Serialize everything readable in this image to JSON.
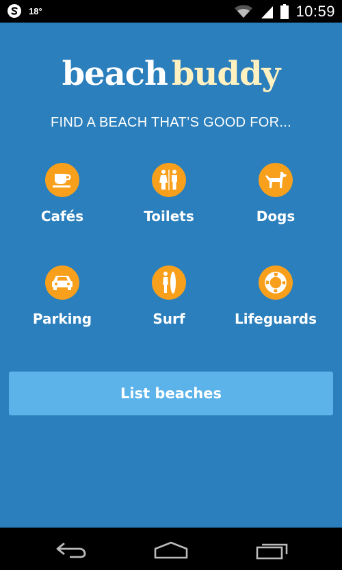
{
  "status_bar": {
    "temperature": "18°",
    "time": "10:59",
    "icons": [
      "app-s-icon",
      "wifi-icon",
      "cell-signal-icon",
      "battery-icon"
    ]
  },
  "logo": {
    "word1": "beach",
    "word2": "buddy"
  },
  "subtitle": "FIND A BEACH THAT’S GOOD FOR...",
  "features": [
    {
      "label": "Cafés",
      "icon": "coffee-cup-icon"
    },
    {
      "label": "Toilets",
      "icon": "toilets-icon"
    },
    {
      "label": "Dogs",
      "icon": "dog-icon"
    },
    {
      "label": "Parking",
      "icon": "car-icon"
    },
    {
      "label": "Surf",
      "icon": "surfer-icon"
    },
    {
      "label": "Lifeguards",
      "icon": "lifebuoy-icon"
    }
  ],
  "list_button": {
    "label": "List beaches"
  },
  "nav_bar": {
    "icons": [
      "back-icon",
      "home-icon",
      "recent-apps-icon"
    ]
  },
  "colors": {
    "background": "#2b7fbc",
    "accent_orange": "#f8a01c",
    "button": "#5cb3ea",
    "logo_secondary": "#fff1c0"
  }
}
